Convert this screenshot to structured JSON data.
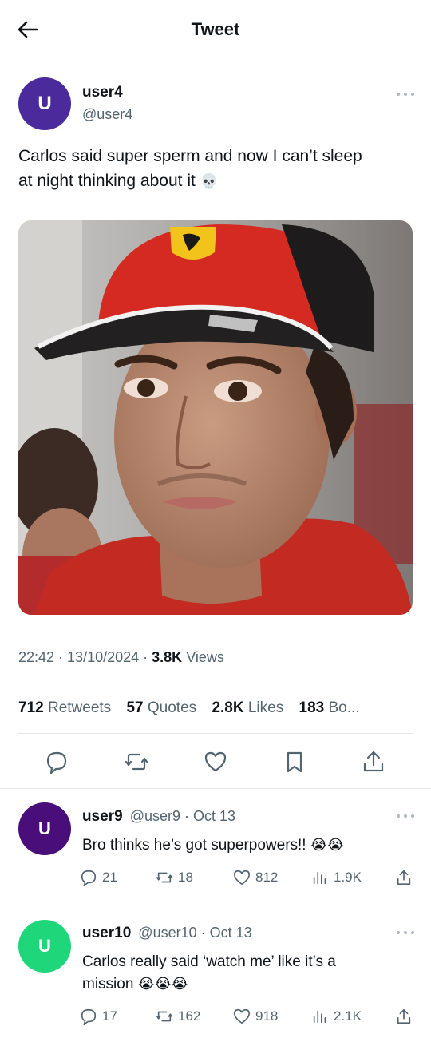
{
  "header": {
    "title": "Tweet"
  },
  "tweet": {
    "avatar_letter": "U",
    "avatar_color": "#4b2a9b",
    "name": "user4",
    "handle": "@user4",
    "text_line1": "Carlos said super sperm and now I can’t sleep",
    "text_line2": "at night thinking about it",
    "text_emoji": "💀",
    "time": "22:42",
    "date": "13/10/2024",
    "views_count": "3.8K",
    "views_label": "Views",
    "stats": {
      "retweets_count": "712",
      "retweets_label": "Retweets",
      "quotes_count": "57",
      "quotes_label": "Quotes",
      "likes_count": "2.8K",
      "likes_label": "Likes",
      "bookmarks_count": "183",
      "bookmarks_label": "Bo..."
    }
  },
  "replies": [
    {
      "avatar_letter": "U",
      "avatar_color": "#4a0e7a",
      "name": "user9",
      "handle": "@user9",
      "date": "· Oct 13",
      "text": "Bro thinks he’s got superpowers!!",
      "emoji": "😭😭",
      "replies": "21",
      "retweets": "18",
      "likes": "812",
      "views": "1.9K"
    },
    {
      "avatar_letter": "U",
      "avatar_color": "#20d67a",
      "name": "user10",
      "handle": "@user10",
      "date": "· Oct 13",
      "text_line1": "Carlos really said ‘watch me’ like it’s a",
      "text_line2": "mission",
      "emoji": "😭😭😭",
      "replies": "17",
      "retweets": "162",
      "likes": "918",
      "views": "2.1K"
    }
  ],
  "colors": {
    "text": "#0f1419",
    "secondary": "#536471",
    "divider": "#e4e8eb"
  }
}
